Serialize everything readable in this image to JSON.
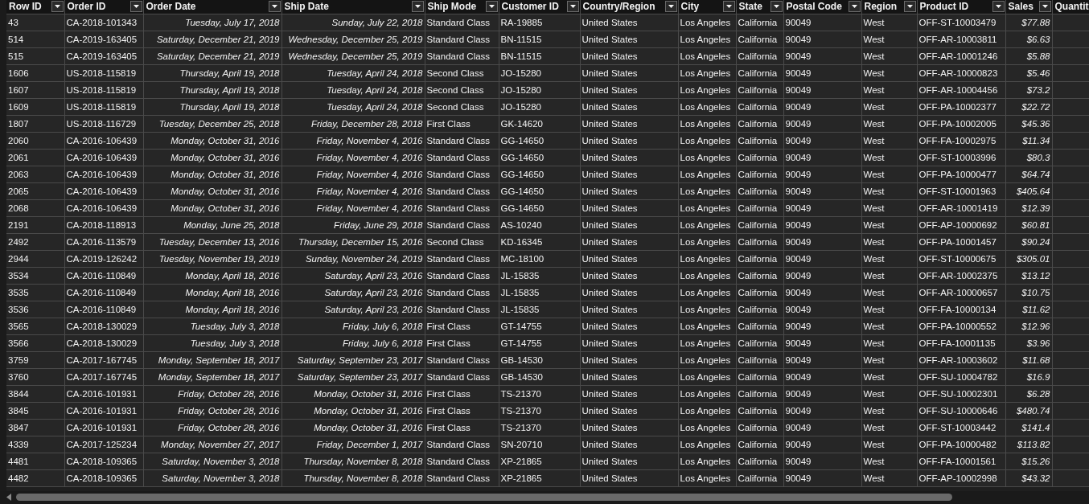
{
  "table": {
    "columns": [
      {
        "label": "Row ID",
        "kind": "text"
      },
      {
        "label": "Order ID",
        "kind": "text"
      },
      {
        "label": "Order Date",
        "kind": "date"
      },
      {
        "label": "Ship Date",
        "kind": "date"
      },
      {
        "label": "Ship Mode",
        "kind": "text"
      },
      {
        "label": "Customer ID",
        "kind": "text"
      },
      {
        "label": "Country/Region",
        "kind": "text"
      },
      {
        "label": "City",
        "kind": "text"
      },
      {
        "label": "State",
        "kind": "text"
      },
      {
        "label": "Postal Code",
        "kind": "text"
      },
      {
        "label": "Region",
        "kind": "text"
      },
      {
        "label": "Product ID",
        "kind": "text"
      },
      {
        "label": "Sales",
        "kind": "currency"
      },
      {
        "label": "Quantit",
        "kind": "text"
      }
    ],
    "rows": [
      [
        "43",
        "CA-2018-101343",
        "Tuesday, July 17, 2018",
        "Sunday, July 22, 2018",
        "Standard Class",
        "RA-19885",
        "United States",
        "Los Angeles",
        "California",
        "90049",
        "West",
        "OFF-ST-10003479",
        "$77.88"
      ],
      [
        "514",
        "CA-2019-163405",
        "Saturday, December 21, 2019",
        "Wednesday, December 25, 2019",
        "Standard Class",
        "BN-11515",
        "United States",
        "Los Angeles",
        "California",
        "90049",
        "West",
        "OFF-AR-10003811",
        "$6.63"
      ],
      [
        "515",
        "CA-2019-163405",
        "Saturday, December 21, 2019",
        "Wednesday, December 25, 2019",
        "Standard Class",
        "BN-11515",
        "United States",
        "Los Angeles",
        "California",
        "90049",
        "West",
        "OFF-AR-10001246",
        "$5.88"
      ],
      [
        "1606",
        "US-2018-115819",
        "Thursday, April 19, 2018",
        "Tuesday, April 24, 2018",
        "Second Class",
        "JO-15280",
        "United States",
        "Los Angeles",
        "California",
        "90049",
        "West",
        "OFF-AR-10000823",
        "$5.46"
      ],
      [
        "1607",
        "US-2018-115819",
        "Thursday, April 19, 2018",
        "Tuesday, April 24, 2018",
        "Second Class",
        "JO-15280",
        "United States",
        "Los Angeles",
        "California",
        "90049",
        "West",
        "OFF-AR-10004456",
        "$73.2"
      ],
      [
        "1609",
        "US-2018-115819",
        "Thursday, April 19, 2018",
        "Tuesday, April 24, 2018",
        "Second Class",
        "JO-15280",
        "United States",
        "Los Angeles",
        "California",
        "90049",
        "West",
        "OFF-PA-10002377",
        "$22.72"
      ],
      [
        "1807",
        "US-2018-116729",
        "Tuesday, December 25, 2018",
        "Friday, December 28, 2018",
        "First Class",
        "GK-14620",
        "United States",
        "Los Angeles",
        "California",
        "90049",
        "West",
        "OFF-PA-10002005",
        "$45.36"
      ],
      [
        "2060",
        "CA-2016-106439",
        "Monday, October 31, 2016",
        "Friday, November 4, 2016",
        "Standard Class",
        "GG-14650",
        "United States",
        "Los Angeles",
        "California",
        "90049",
        "West",
        "OFF-FA-10002975",
        "$11.34"
      ],
      [
        "2061",
        "CA-2016-106439",
        "Monday, October 31, 2016",
        "Friday, November 4, 2016",
        "Standard Class",
        "GG-14650",
        "United States",
        "Los Angeles",
        "California",
        "90049",
        "West",
        "OFF-ST-10003996",
        "$80.3"
      ],
      [
        "2063",
        "CA-2016-106439",
        "Monday, October 31, 2016",
        "Friday, November 4, 2016",
        "Standard Class",
        "GG-14650",
        "United States",
        "Los Angeles",
        "California",
        "90049",
        "West",
        "OFF-PA-10000477",
        "$64.74"
      ],
      [
        "2065",
        "CA-2016-106439",
        "Monday, October 31, 2016",
        "Friday, November 4, 2016",
        "Standard Class",
        "GG-14650",
        "United States",
        "Los Angeles",
        "California",
        "90049",
        "West",
        "OFF-ST-10001963",
        "$405.64"
      ],
      [
        "2068",
        "CA-2016-106439",
        "Monday, October 31, 2016",
        "Friday, November 4, 2016",
        "Standard Class",
        "GG-14650",
        "United States",
        "Los Angeles",
        "California",
        "90049",
        "West",
        "OFF-AR-10001419",
        "$12.39"
      ],
      [
        "2191",
        "CA-2018-118913",
        "Monday, June 25, 2018",
        "Friday, June 29, 2018",
        "Standard Class",
        "AS-10240",
        "United States",
        "Los Angeles",
        "California",
        "90049",
        "West",
        "OFF-AP-10000692",
        "$60.81"
      ],
      [
        "2492",
        "CA-2016-113579",
        "Tuesday, December 13, 2016",
        "Thursday, December 15, 2016",
        "Second Class",
        "KD-16345",
        "United States",
        "Los Angeles",
        "California",
        "90049",
        "West",
        "OFF-PA-10001457",
        "$90.24"
      ],
      [
        "2944",
        "CA-2019-126242",
        "Tuesday, November 19, 2019",
        "Sunday, November 24, 2019",
        "Standard Class",
        "MC-18100",
        "United States",
        "Los Angeles",
        "California",
        "90049",
        "West",
        "OFF-ST-10000675",
        "$305.01"
      ],
      [
        "3534",
        "CA-2016-110849",
        "Monday, April 18, 2016",
        "Saturday, April 23, 2016",
        "Standard Class",
        "JL-15835",
        "United States",
        "Los Angeles",
        "California",
        "90049",
        "West",
        "OFF-AR-10002375",
        "$13.12"
      ],
      [
        "3535",
        "CA-2016-110849",
        "Monday, April 18, 2016",
        "Saturday, April 23, 2016",
        "Standard Class",
        "JL-15835",
        "United States",
        "Los Angeles",
        "California",
        "90049",
        "West",
        "OFF-AR-10000657",
        "$10.75"
      ],
      [
        "3536",
        "CA-2016-110849",
        "Monday, April 18, 2016",
        "Saturday, April 23, 2016",
        "Standard Class",
        "JL-15835",
        "United States",
        "Los Angeles",
        "California",
        "90049",
        "West",
        "OFF-FA-10000134",
        "$11.62"
      ],
      [
        "3565",
        "CA-2018-130029",
        "Tuesday, July 3, 2018",
        "Friday, July 6, 2018",
        "First Class",
        "GT-14755",
        "United States",
        "Los Angeles",
        "California",
        "90049",
        "West",
        "OFF-PA-10000552",
        "$12.96"
      ],
      [
        "3566",
        "CA-2018-130029",
        "Tuesday, July 3, 2018",
        "Friday, July 6, 2018",
        "First Class",
        "GT-14755",
        "United States",
        "Los Angeles",
        "California",
        "90049",
        "West",
        "OFF-FA-10001135",
        "$3.96"
      ],
      [
        "3759",
        "CA-2017-167745",
        "Monday, September 18, 2017",
        "Saturday, September 23, 2017",
        "Standard Class",
        "GB-14530",
        "United States",
        "Los Angeles",
        "California",
        "90049",
        "West",
        "OFF-AR-10003602",
        "$11.68"
      ],
      [
        "3760",
        "CA-2017-167745",
        "Monday, September 18, 2017",
        "Saturday, September 23, 2017",
        "Standard Class",
        "GB-14530",
        "United States",
        "Los Angeles",
        "California",
        "90049",
        "West",
        "OFF-SU-10004782",
        "$16.9"
      ],
      [
        "3844",
        "CA-2016-101931",
        "Friday, October 28, 2016",
        "Monday, October 31, 2016",
        "First Class",
        "TS-21370",
        "United States",
        "Los Angeles",
        "California",
        "90049",
        "West",
        "OFF-SU-10002301",
        "$6.28"
      ],
      [
        "3845",
        "CA-2016-101931",
        "Friday, October 28, 2016",
        "Monday, October 31, 2016",
        "First Class",
        "TS-21370",
        "United States",
        "Los Angeles",
        "California",
        "90049",
        "West",
        "OFF-SU-10000646",
        "$480.74"
      ],
      [
        "3847",
        "CA-2016-101931",
        "Friday, October 28, 2016",
        "Monday, October 31, 2016",
        "First Class",
        "TS-21370",
        "United States",
        "Los Angeles",
        "California",
        "90049",
        "West",
        "OFF-ST-10003442",
        "$141.4"
      ],
      [
        "4339",
        "CA-2017-125234",
        "Monday, November 27, 2017",
        "Friday, December 1, 2017",
        "Standard Class",
        "SN-20710",
        "United States",
        "Los Angeles",
        "California",
        "90049",
        "West",
        "OFF-PA-10000482",
        "$113.82"
      ],
      [
        "4481",
        "CA-2018-109365",
        "Saturday, November 3, 2018",
        "Thursday, November 8, 2018",
        "Standard Class",
        "XP-21865",
        "United States",
        "Los Angeles",
        "California",
        "90049",
        "West",
        "OFF-FA-10001561",
        "$15.26"
      ],
      [
        "4482",
        "CA-2018-109365",
        "Saturday, November 3, 2018",
        "Thursday, November 8, 2018",
        "Standard Class",
        "XP-21865",
        "United States",
        "Los Angeles",
        "California",
        "90049",
        "West",
        "OFF-AP-10002998",
        "$43.32"
      ]
    ]
  }
}
